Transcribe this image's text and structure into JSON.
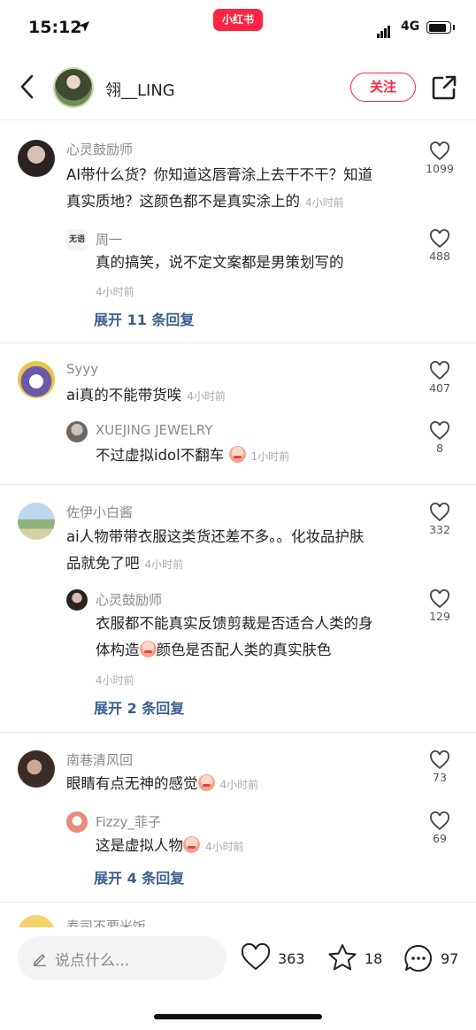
{
  "status_bar": {
    "time": "15:12",
    "app_badge": "小红书",
    "network": "4G"
  },
  "header": {
    "author_name": "翎__LING",
    "follow_label": "关注"
  },
  "threads": [
    {
      "user": "心灵鼓励师",
      "text_line1": "AI带什么货？你知道这唇膏涂上去干不干？知道",
      "text_line2": "真实质地？这颜色都不是真实涂上的",
      "time": "4小时前",
      "likes": "1099",
      "reply": {
        "user": "周一",
        "text": "真的搞笑，说不定文案都是男策划写的",
        "time": "4小时前",
        "likes": "488"
      },
      "expand": "展开 11 条回复"
    },
    {
      "user": "Syyy",
      "text_line1": "ai真的不能带货唉",
      "time": "4小时前",
      "likes": "407",
      "reply": {
        "user": "XUEJING JEWELRY",
        "text": "不过虚拟idol不翻车",
        "time": "1小时前",
        "likes": "8"
      }
    },
    {
      "user": "佐伊小白酱",
      "text_line1": "ai人物带带衣服这类货还差不多。。化妆品护肤",
      "text_line2": "品就免了吧",
      "time": "4小时前",
      "likes": "332",
      "reply": {
        "user": "心灵鼓励师",
        "text_line1": "衣服都不能真实反馈剪裁是否适合人类的身",
        "text_line2a": "体构造",
        "text_line2b": "颜色是否配人类的真实肤色",
        "time": "4小时前",
        "likes": "129"
      },
      "expand": "展开 2 条回复"
    },
    {
      "user": "南巷清风回",
      "text_line1": "眼睛有点无神的感觉",
      "time": "4小时前",
      "likes": "73",
      "reply": {
        "user": "Fizzy_菲子",
        "text": "这是虚拟人物",
        "time": "4小时前",
        "likes": "69"
      },
      "expand": "展开 4 条回复"
    }
  ],
  "peek_user": "寿司不要米饭",
  "bottom_bar": {
    "input_placeholder": "说点什么...",
    "likes": "363",
    "stars": "18",
    "comments": "97"
  },
  "colors": {
    "brand": "#ff2442",
    "link": "#3a5f8f"
  }
}
